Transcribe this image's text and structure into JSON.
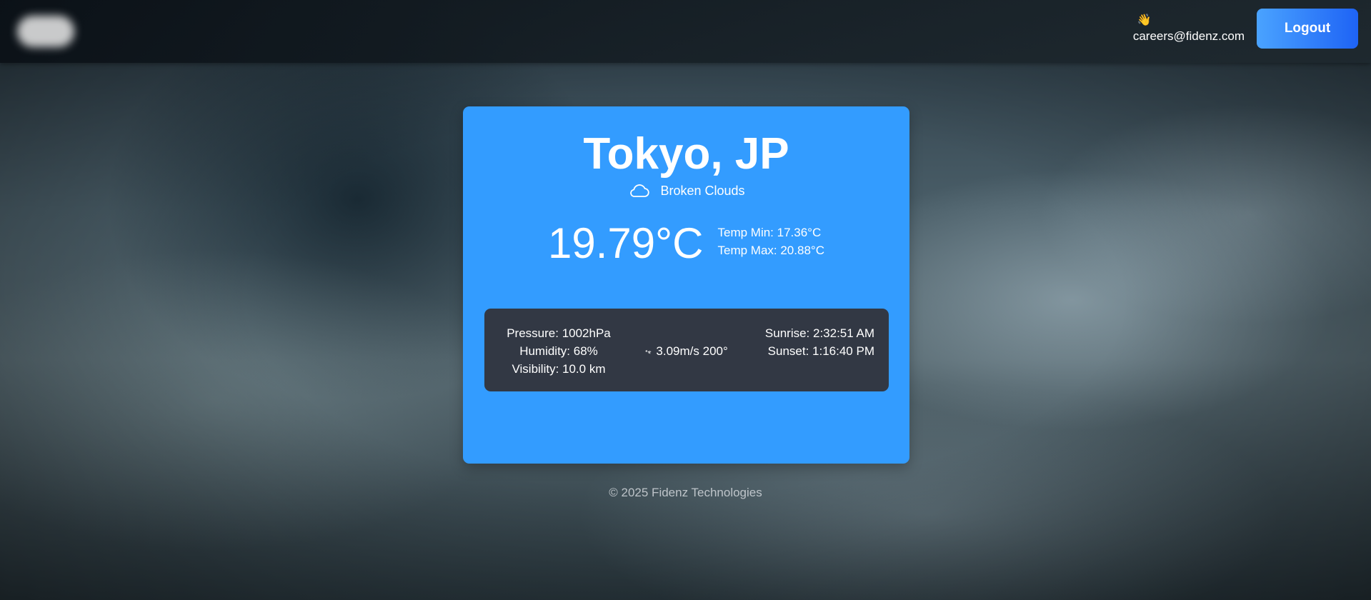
{
  "header": {
    "user_wave": "👋",
    "user_email": "careers@fidenz.com",
    "logout_label": "Logout"
  },
  "weather": {
    "city": "Tokyo, JP",
    "description": "Broken Clouds",
    "icon": "cloud-icon",
    "temperature": "19.79°C",
    "temp_min": "Temp Min: 17.36°C",
    "temp_max": "Temp Max: 20.88°C",
    "pressure": "Pressure: 1002hPa",
    "humidity": "Humidity: 68%",
    "visibility": "Visibility: 10.0 km",
    "wind": "3.09m/s 200°",
    "wind_icon": "wind-direction-arrow-icon",
    "sunrise": "Sunrise: 2:32:51 AM",
    "sunset": "Sunset: 1:16:40 PM"
  },
  "footer": {
    "copyright": "© 2025 Fidenz Technologies"
  },
  "colors": {
    "card": "#339cff",
    "details_panel": "#323844",
    "logout_gradient_start": "#4aa3ff",
    "logout_gradient_end": "#1e63f5"
  }
}
